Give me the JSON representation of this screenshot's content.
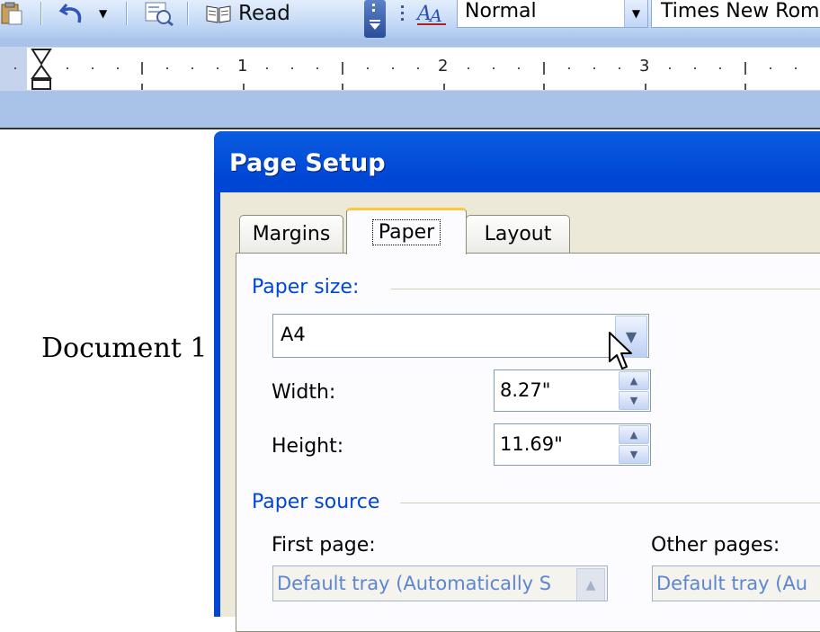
{
  "toolbar": {
    "read_label": "Read",
    "style_value": "Normal",
    "font_value": "Times New Roman"
  },
  "ruler": {
    "numbers": [
      "1",
      "2",
      "3"
    ]
  },
  "document": {
    "text": "Document 1"
  },
  "dialog": {
    "title": "Page Setup",
    "tabs": [
      {
        "label": "Margins",
        "active": false
      },
      {
        "label": "Paper",
        "active": true
      },
      {
        "label": "Layout",
        "active": false
      }
    ],
    "paper_size": {
      "group_label": "Paper size:",
      "value": "A4",
      "width_label": "Width:",
      "width_value": "8.27\"",
      "height_label": "Height:",
      "height_value": "11.69\""
    },
    "paper_source": {
      "group_label": "Paper source",
      "first_page_label": "First page:",
      "first_page_value": "Default tray (Automatically S",
      "other_pages_label": "Other pages:",
      "other_pages_value": "Default tray (Au"
    }
  },
  "colors": {
    "title_bar": "#0046d5",
    "dialog_body": "#ece9d8",
    "group_label": "#0046d5",
    "active_tab_accent": "#ffc83c"
  }
}
